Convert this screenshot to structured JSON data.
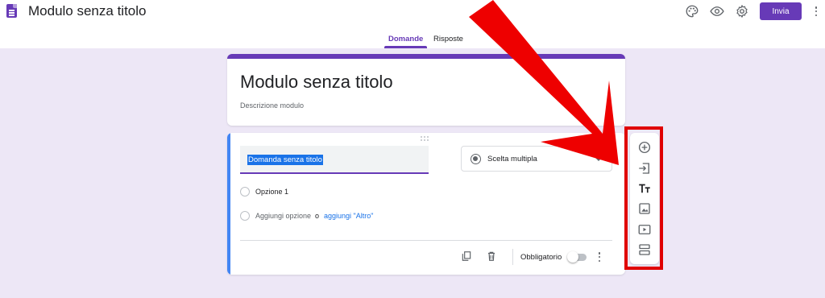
{
  "header": {
    "doc_title": "Modulo senza titolo",
    "send_label": "Invia",
    "icons": [
      "docs-forms-icon",
      "palette-icon",
      "eye-preview-icon",
      "settings-gear-icon",
      "more-vert-icon"
    ]
  },
  "tabs": [
    {
      "label": "Domande",
      "active": true
    },
    {
      "label": "Risposte",
      "active": false
    }
  ],
  "form": {
    "title": "Modulo senza titolo",
    "description_placeholder": "Descrizione modulo"
  },
  "question": {
    "title": "Domanda senza titolo",
    "type": "Scelta multipla",
    "options": [
      "Opzione 1"
    ],
    "add_option": "Aggiungi opzione",
    "or": "o",
    "add_other": "aggiungi \"Altro\"",
    "required_label": "Obbligatorio",
    "required": false
  },
  "side_toolbar": {
    "items": [
      "add-question-icon",
      "import-questions-icon",
      "add-title-description-icon",
      "add-image-icon",
      "add-video-icon",
      "add-section-icon"
    ]
  },
  "colors": {
    "accent": "#673ab7",
    "background": "#ede7f6",
    "active_question_bar": "#4285f4",
    "annotation_red": "#e00000"
  }
}
